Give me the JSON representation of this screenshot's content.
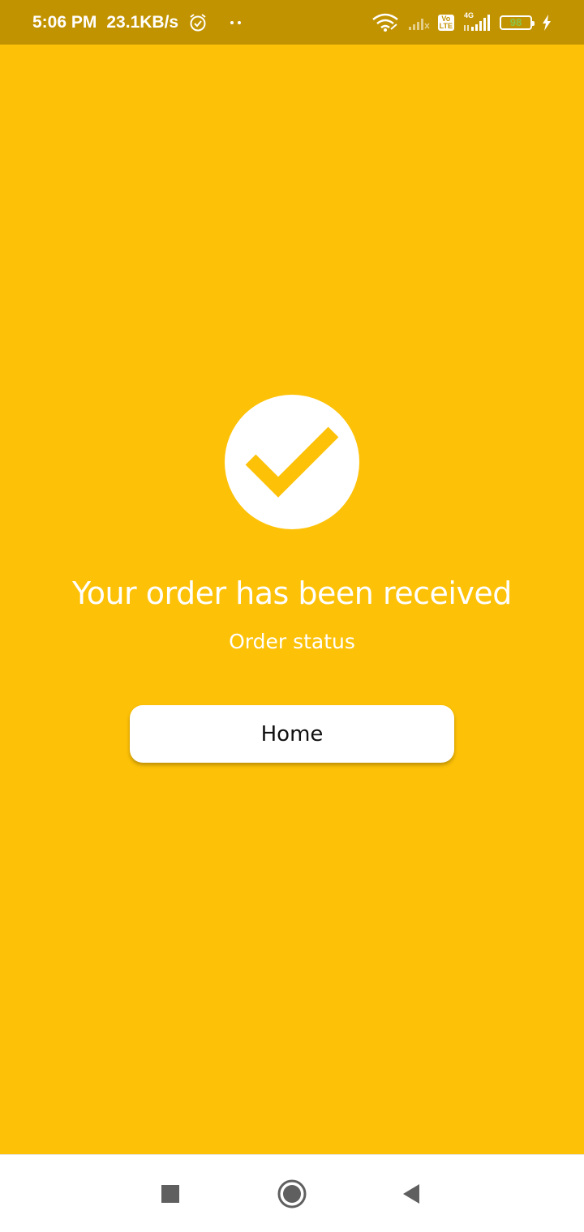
{
  "status_bar": {
    "time": "5:06 PM",
    "net_speed": "23.1KB/s",
    "network_type": "4G",
    "volte_label_top": "Vo",
    "volte_label_bottom": "LTE",
    "battery_level": "98",
    "icons": [
      "alarm-icon",
      "wifi-icon",
      "signal-icon",
      "charging-icon"
    ]
  },
  "main": {
    "background_color": "#fdc107",
    "check_icon": "check-circle-icon",
    "title": "Your order has been received",
    "subtitle": "Order status",
    "home_button_label": "Home"
  },
  "nav_bar": {
    "buttons": [
      "recent-apps-icon",
      "home-icon",
      "back-icon"
    ]
  }
}
